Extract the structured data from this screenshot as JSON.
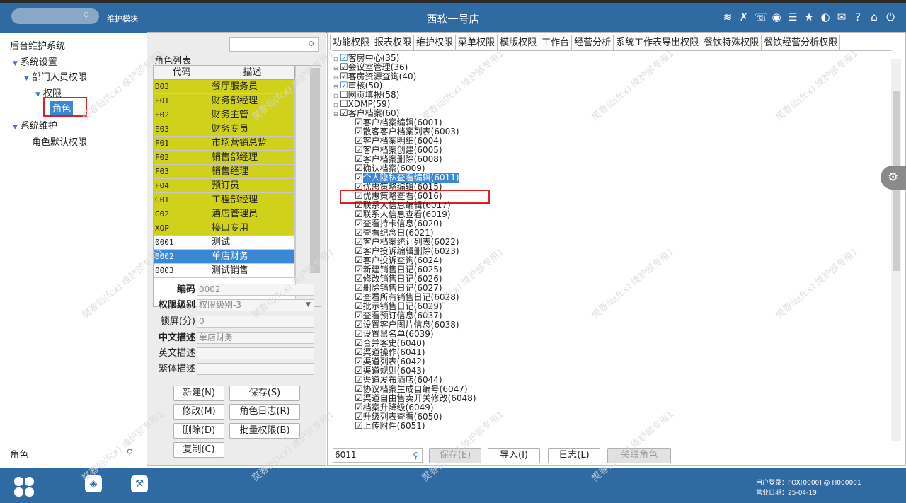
{
  "app": {
    "title": "西软一号店",
    "module": "维护模块"
  },
  "top_icons": [
    {
      "name": "wifi-icon",
      "glyph": "≋"
    },
    {
      "name": "tools-icon",
      "glyph": "✗"
    },
    {
      "name": "phone-icon",
      "glyph": "☏"
    },
    {
      "name": "palette-icon",
      "glyph": "◉"
    },
    {
      "name": "menu-icon",
      "glyph": "☰"
    },
    {
      "name": "star-icon",
      "glyph": "★"
    },
    {
      "name": "contrast-icon",
      "glyph": "◐"
    },
    {
      "name": "mail-icon",
      "glyph": "✉"
    },
    {
      "name": "help-icon",
      "glyph": "?"
    },
    {
      "name": "home-icon",
      "glyph": "⌂"
    },
    {
      "name": "power-icon",
      "glyph": "⏻"
    }
  ],
  "left_tree": {
    "root": "后台维护系统",
    "system_settings": "系统设置",
    "dept_perm": "部门人员权限",
    "perm": "权限",
    "role": "角色",
    "system_maint": "系统维护",
    "role_default_perm": "角色默认权限",
    "search_value": "角色"
  },
  "role_panel": {
    "list_caption": "角色列表",
    "col_code": "代码",
    "col_desc": "描述",
    "rows": [
      {
        "code": "D03",
        "desc": "餐厅服务员",
        "style": "y"
      },
      {
        "code": "E01",
        "desc": "财务部经理",
        "style": "y"
      },
      {
        "code": "E02",
        "desc": "财务主管",
        "style": "y"
      },
      {
        "code": "E03",
        "desc": "财务专员",
        "style": "y"
      },
      {
        "code": "F01",
        "desc": "市场营销总监",
        "style": "y"
      },
      {
        "code": "F02",
        "desc": "销售部经理",
        "style": "y"
      },
      {
        "code": "F03",
        "desc": "销售经理",
        "style": "y"
      },
      {
        "code": "F04",
        "desc": "预订员",
        "style": "y"
      },
      {
        "code": "G01",
        "desc": "工程部经理",
        "style": "y"
      },
      {
        "code": "G02",
        "desc": "酒店管理员",
        "style": "y"
      },
      {
        "code": "XOP",
        "desc": "接口专用",
        "style": "y"
      },
      {
        "code": "0001",
        "desc": "测试",
        "style": ""
      },
      {
        "code": "0002",
        "desc": "单店财务",
        "style": "s"
      },
      {
        "code": "0003",
        "desc": "测试销售",
        "style": ""
      }
    ],
    "form": {
      "code_label": "编码",
      "code_value": "0002",
      "level_label": "权限级别",
      "level_value": "权限级别-3",
      "lock_label": "锁屏(分)",
      "lock_value": "0",
      "cn_label": "中文描述",
      "cn_value": "单店财务",
      "en_label": "英文描述",
      "en_value": "",
      "tw_label": "繁体描述",
      "tw_value": ""
    },
    "buttons": {
      "new": "新建(N)",
      "save": "保存(S)",
      "modify": "修改(M)",
      "role_log": "角色日志(R)",
      "delete": "删除(D)",
      "batch_perm": "批量权限(B)",
      "copy": "复制(C)"
    }
  },
  "perm_panel": {
    "tabs": [
      "功能权限",
      "报表权限",
      "维护权限",
      "菜单权限",
      "模版权限",
      "工作台",
      "经营分析",
      "系统工作表导出权限",
      "餐饮特殊权限",
      "餐饮经营分析权限"
    ],
    "items": [
      {
        "t": "客房中心(35)",
        "lvl": 0,
        "ex": "⊞",
        "cb": "☑",
        "blue": true
      },
      {
        "t": "会议室管理(36)",
        "lvl": 0,
        "ex": "⊞",
        "cb": "☑"
      },
      {
        "t": "客房资源查询(40)",
        "lvl": 0,
        "ex": "⊞",
        "cb": "☑"
      },
      {
        "t": "审核(50)",
        "lvl": 0,
        "ex": "⊞",
        "cb": "☑",
        "blue": true
      },
      {
        "t": "网页填报(58)",
        "lvl": 0,
        "ex": "⊞",
        "cb": "☐"
      },
      {
        "t": "XDMP(59)",
        "lvl": 0,
        "ex": "⊞",
        "cb": "☐"
      },
      {
        "t": "客户档案(60)",
        "lvl": 0,
        "ex": "⊟",
        "cb": "☑"
      },
      {
        "t": "客户档案编辑(6001)",
        "lvl": 1,
        "cb": "☑"
      },
      {
        "t": "散客客户档案列表(6003)",
        "lvl": 1,
        "cb": "☑"
      },
      {
        "t": "客户档案明细(6004)",
        "lvl": 1,
        "cb": "☑"
      },
      {
        "t": "客户档案创建(6005)",
        "lvl": 1,
        "cb": "☑"
      },
      {
        "t": "客户档案删除(6008)",
        "lvl": 1,
        "cb": "☑"
      },
      {
        "t": "确认档案(6009)",
        "lvl": 1,
        "cb": "☑"
      },
      {
        "t": "个人隐私查看编辑(6011)",
        "lvl": 1,
        "cb": "☑",
        "hl": true
      },
      {
        "t": "优惠策略编辑(6015)",
        "lvl": 1,
        "cb": "☑"
      },
      {
        "t": "优惠策略查看(6016)",
        "lvl": 1,
        "cb": "☑"
      },
      {
        "t": "联系人信息编辑(6017)",
        "lvl": 1,
        "cb": "☑"
      },
      {
        "t": "联系人信息查看(6019)",
        "lvl": 1,
        "cb": "☑"
      },
      {
        "t": "查看持卡信息(6020)",
        "lvl": 1,
        "cb": "☑"
      },
      {
        "t": "查看纪念日(6021)",
        "lvl": 1,
        "cb": "☑"
      },
      {
        "t": "客户档案统计列表(6022)",
        "lvl": 1,
        "cb": "☑"
      },
      {
        "t": "客户投诉编辑删除(6023)",
        "lvl": 1,
        "cb": "☑"
      },
      {
        "t": "客户投诉查询(6024)",
        "lvl": 1,
        "cb": "☑"
      },
      {
        "t": "新建销售日记(6025)",
        "lvl": 1,
        "cb": "☑"
      },
      {
        "t": "修改销售日记(6026)",
        "lvl": 1,
        "cb": "☑"
      },
      {
        "t": "删除销售日记(6027)",
        "lvl": 1,
        "cb": "☑"
      },
      {
        "t": "查看所有销售日记(6028)",
        "lvl": 1,
        "cb": "☑"
      },
      {
        "t": "批示销售日记(6029)",
        "lvl": 1,
        "cb": "☑"
      },
      {
        "t": "查看预订信息(6037)",
        "lvl": 1,
        "cb": "☑"
      },
      {
        "t": "设置客户图片信息(6038)",
        "lvl": 1,
        "cb": "☑"
      },
      {
        "t": "设置黑名单(6039)",
        "lvl": 1,
        "cb": "☑"
      },
      {
        "t": "合并客史(6040)",
        "lvl": 1,
        "cb": "☑"
      },
      {
        "t": "渠道操作(6041)",
        "lvl": 1,
        "cb": "☑"
      },
      {
        "t": "渠道列表(6042)",
        "lvl": 1,
        "cb": "☑"
      },
      {
        "t": "渠道规则(6043)",
        "lvl": 1,
        "cb": "☑"
      },
      {
        "t": "渠道发布酒店(6044)",
        "lvl": 1,
        "cb": "☑"
      },
      {
        "t": "协议档案生成自编号(6047)",
        "lvl": 1,
        "cb": "☑"
      },
      {
        "t": "渠道自由售卖开关修改(6048)",
        "lvl": 1,
        "cb": "☑"
      },
      {
        "t": "档案升降级(6049)",
        "lvl": 1,
        "cb": "☑"
      },
      {
        "t": "升级列表查看(6050)",
        "lvl": 1,
        "cb": "☑"
      },
      {
        "t": "上传附件(6051)",
        "lvl": 1,
        "cb": "☑"
      }
    ],
    "search_value": "6011",
    "buttons": {
      "save": "保存(E)",
      "import": "导入(I)",
      "log": "日志(L)",
      "link_role": "关联角色"
    }
  },
  "status": {
    "user_line": "用户登录：FOX[0000] @ H000001",
    "date_line": "营业日期：25-04-19"
  },
  "watermark": "樊春仙(fcx) 维护部专用1",
  "colors": {
    "accent": "#2f6aa3",
    "select": "#3a87d6",
    "highlight_row": "#cfd11a",
    "alert_border": "#e02020"
  }
}
